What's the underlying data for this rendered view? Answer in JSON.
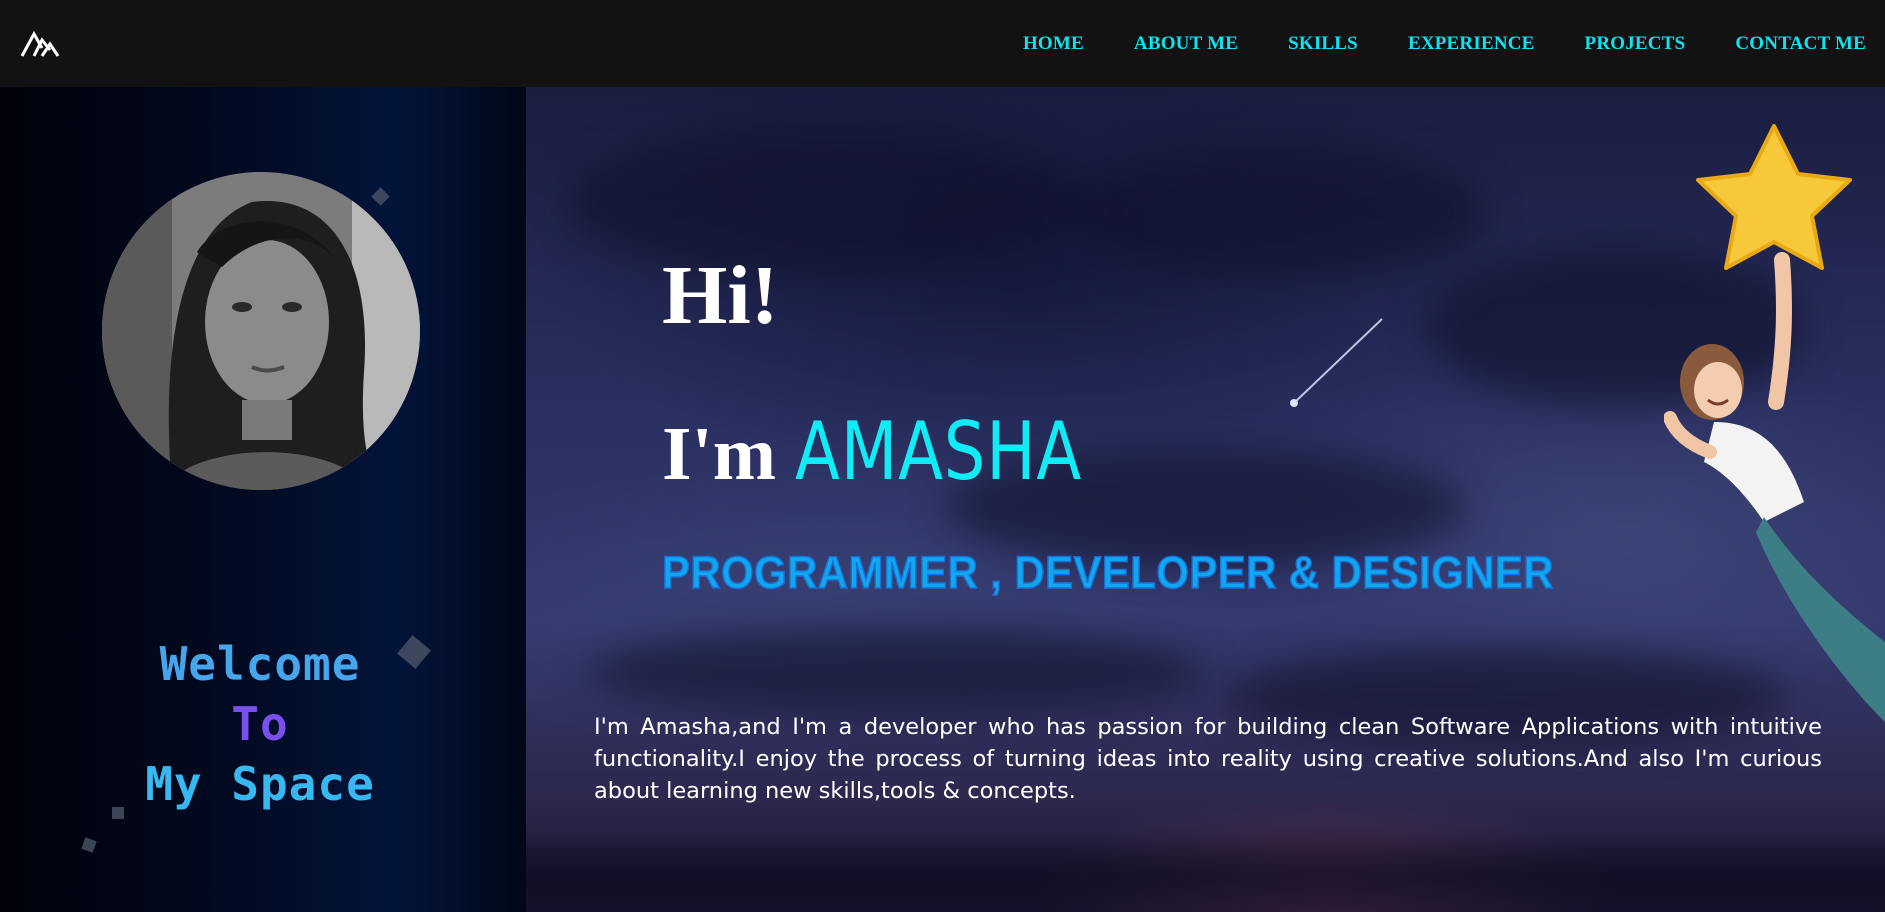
{
  "nav": {
    "logo_icon": "mountain-logo-icon",
    "links": [
      "HOME",
      "ABOUT ME",
      "SKILLS",
      "EXPERIENCE",
      "PROJECTS",
      "CONTACT ME"
    ],
    "link_color": "#0fe3ef"
  },
  "left": {
    "welcome_line1": "Welcome",
    "welcome_line2": "To",
    "welcome_line3": "My Space"
  },
  "hero": {
    "greeting": "Hi!",
    "iam_prefix": "I'm",
    "name": "AMASHA",
    "role": "PROGRAMMER , DEVELOPER & DESIGNER",
    "intro": "I'm Amasha,and I'm a developer who has passion for building clean Software Applications with intuitive functionality.I enjoy the process of turning ideas into reality using creative solutions.And also I'm curious about learning new skills,tools & concepts.",
    "accent_color": "#10ecf5",
    "role_color": "#0ea7f0"
  }
}
